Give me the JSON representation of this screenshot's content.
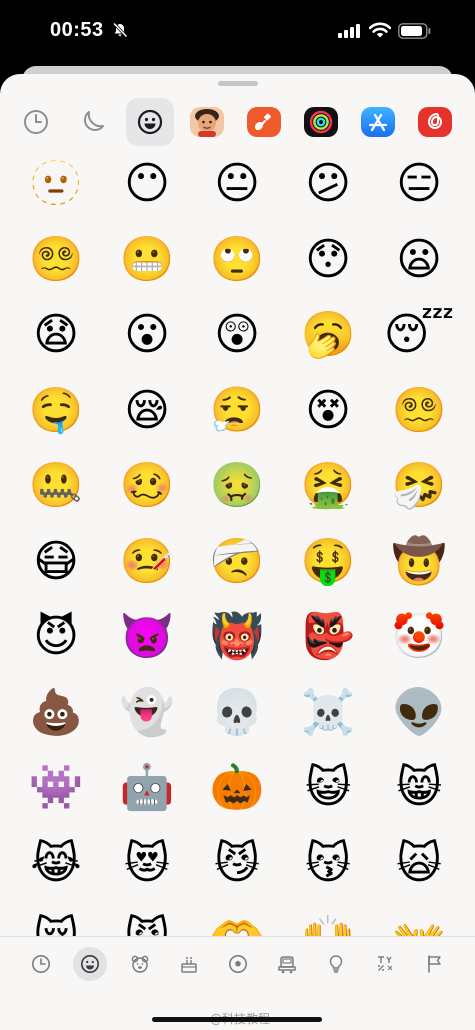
{
  "status_bar": {
    "time": "00:53"
  },
  "top_categories": [
    {
      "name": "recent-icon"
    },
    {
      "name": "moon-icon"
    },
    {
      "name": "smiley-icon",
      "active": true
    },
    {
      "name": "memoji-sticker-icon"
    },
    {
      "name": "garageband-app-icon",
      "color": "#ee5a2b"
    },
    {
      "name": "fitness-app-icon",
      "color": "#111111"
    },
    {
      "name": "app-store-icon",
      "color": "#2f8cf5"
    },
    {
      "name": "netease-music-app-icon",
      "color": "#e7312b"
    }
  ],
  "emoji_rows": [
    [
      "🫥",
      "😶",
      "😐",
      "😕",
      "😑"
    ],
    [
      "😵‍💫",
      "😬",
      "🙄",
      "😯",
      "😦"
    ],
    [
      "😧",
      "😮",
      "😲",
      "🥱",
      "😴"
    ],
    [
      "🤤",
      "😪",
      "😮‍💨",
      "😵",
      "😵‍💫"
    ],
    [
      "🤐",
      "🥴",
      "🤢",
      "🤮",
      "🤧"
    ],
    [
      "😷",
      "🤒",
      "🤕",
      "🤑",
      "🤠"
    ],
    [
      "😈",
      "👿",
      "👹",
      "👺",
      "🤡"
    ],
    [
      "💩",
      "👻",
      "💀",
      "☠️",
      "👽"
    ],
    [
      "👾",
      "🤖",
      "🎃",
      "😺",
      "😸"
    ],
    [
      "😹",
      "😻",
      "😼",
      "😽",
      "🙀"
    ],
    [
      "😿",
      "😾",
      "🫶",
      "🙌",
      "👐"
    ]
  ],
  "bottom_categories": [
    {
      "name": "recent-icon"
    },
    {
      "name": "smileys-people-icon",
      "active": true
    },
    {
      "name": "animals-nature-icon"
    },
    {
      "name": "food-drink-icon"
    },
    {
      "name": "activity-icon"
    },
    {
      "name": "travel-places-icon"
    },
    {
      "name": "objects-icon"
    },
    {
      "name": "symbols-icon"
    },
    {
      "name": "flags-icon"
    }
  ],
  "watermark": "@科技教程"
}
